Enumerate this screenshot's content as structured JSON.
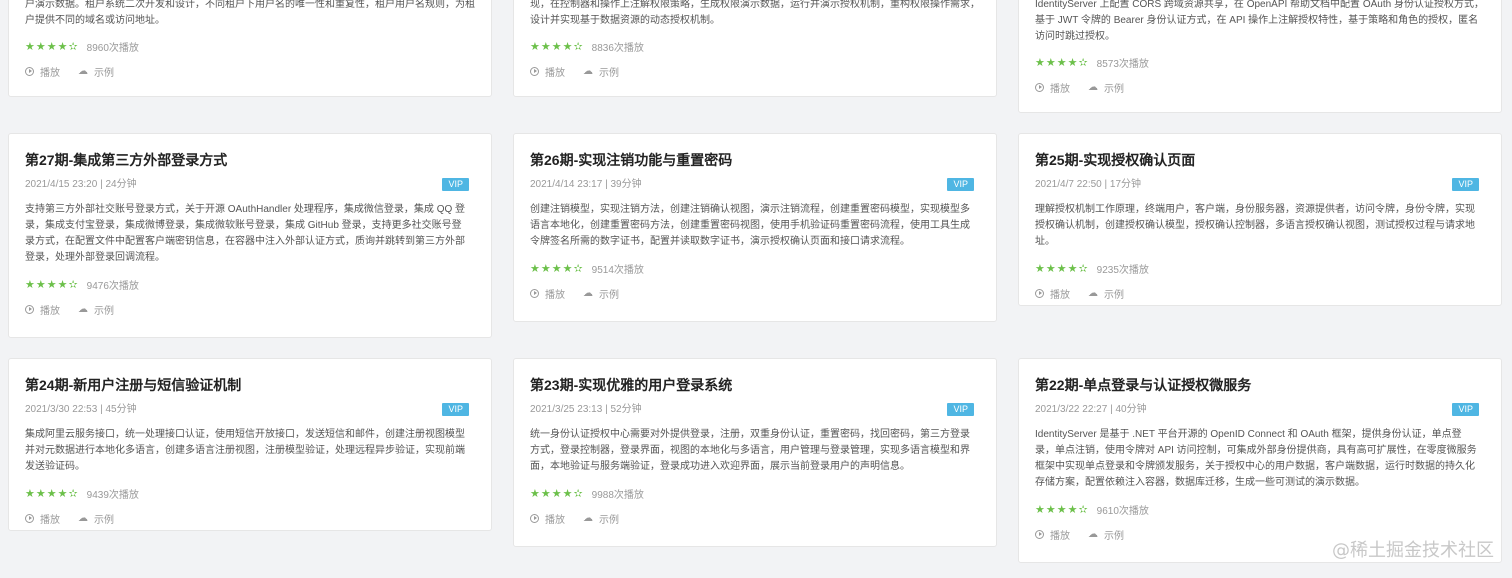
{
  "colors": {
    "accent_vip": "#4fb6e3",
    "stars": "#6cc04a",
    "background": "#f2f3f5"
  },
  "labels": {
    "play": "播放",
    "example": "示例",
    "vip": "VIP"
  },
  "top_row": [
    {
      "desc": "户演示数据。租户系统二次开发和设计，不同租户下用户名的唯一性和重复性，租户用户名规则，为租户提供不同的域名或访问地址。",
      "stars": "★★★★✫",
      "plays": "8960次播放"
    },
    {
      "desc": "现，在控制器和操作上注解权限策略，生成权限演示数据，运行并演示授权机制，重构权限操作需求，设计并实现基于数据资源的动态授权机制。",
      "stars": "★★★★✫",
      "plays": "8836次播放"
    },
    {
      "desc": "IdentityServer 上配置 CORS 跨域资源共享，在 OpenAPI 帮助文档中配置 OAuth 身份认证授权方式，基于 JWT 令牌的 Bearer 身份认证方式，在 API 操作上注解授权特性，基于策略和角色的授权，匿名访问时跳过授权。",
      "stars": "★★★★✫",
      "plays": "8573次播放"
    }
  ],
  "cards": [
    {
      "title": "第27期-集成第三方外部登录方式",
      "meta": "2021/4/15 23:20 | 24分钟",
      "desc": "支持第三方外部社交账号登录方式，关于开源 OAuthHandler 处理程序，集成微信登录，集成 QQ 登录，集成支付宝登录，集成微博登录，集成微软账号登录，集成 GitHub 登录，支持更多社交账号登录方式，在配置文件中配置客户端密钥信息，在容器中注入外部认证方式，质询并跳转到第三方外部登录，处理外部登录回调流程。",
      "stars": "★★★★✫",
      "plays": "9476次播放"
    },
    {
      "title": "第26期-实现注销功能与重置密码",
      "meta": "2021/4/14 23:17 | 39分钟",
      "desc": "创建注销模型，实现注销方法，创建注销确认视图，演示注销流程，创建重置密码模型，实现模型多语言本地化，创建重置密码方法，创建重置密码视图，使用手机验证码重置密码流程，使用工具生成令牌签名所需的数字证书，配置并读取数字证书，演示授权确认页面和接口请求流程。",
      "stars": "★★★★✫",
      "plays": "9514次播放"
    },
    {
      "title": "第25期-实现授权确认页面",
      "meta": "2021/4/7 22:50 | 17分钟",
      "desc": "理解授权机制工作原理，终端用户，客户端，身份服务器，资源提供者，访问令牌，身份令牌，实现授权确认机制，创建授权确认模型，授权确认控制器，多语言授权确认视图，测试授权过程与请求地址。",
      "stars": "★★★★✫",
      "plays": "9235次播放"
    },
    {
      "title": "第24期-新用户注册与短信验证机制",
      "meta": "2021/3/30 22:53 | 45分钟",
      "desc": "集成阿里云服务接口，统一处理接口认证，使用短信开放接口，发送短信和邮件，创建注册视图模型并对元数据进行本地化多语言，创建多语言注册视图，注册模型验证，处理远程异步验证，实现前端发送验证码。",
      "stars": "★★★★✫",
      "plays": "9439次播放"
    },
    {
      "title": "第23期-实现优雅的用户登录系统",
      "meta": "2021/3/25 23:13 | 52分钟",
      "desc": "统一身份认证授权中心需要对外提供登录，注册，双重身份认证，重置密码，找回密码，第三方登录方式，登录控制器，登录界面，视图的本地化与多语言，用户管理与登录管理，实现多语言模型和界面，本地验证与服务端验证，登录成功进入欢迎界面，展示当前登录用户的声明信息。",
      "stars": "★★★★✫",
      "plays": "9988次播放"
    },
    {
      "title": "第22期-单点登录与认证授权微服务",
      "meta": "2021/3/22 22:27 | 40分钟",
      "desc": "IdentityServer 是基于 .NET 平台开源的 OpenID Connect 和 OAuth 框架，提供身份认证，单点登录，单点注销，使用令牌对 API 访问控制，可集成外部身份提供商，具有高可扩展性，在零度微服务框架中实现单点登录和令牌颁发服务，关于授权中心的用户数据，客户端数据，运行时数据的持久化存储方案，配置依赖注入容器，数据库迁移，生成一些可测试的演示数据。",
      "stars": "★★★★✫",
      "plays": "9610次播放"
    }
  ],
  "watermark": "@稀土掘金技术社区"
}
